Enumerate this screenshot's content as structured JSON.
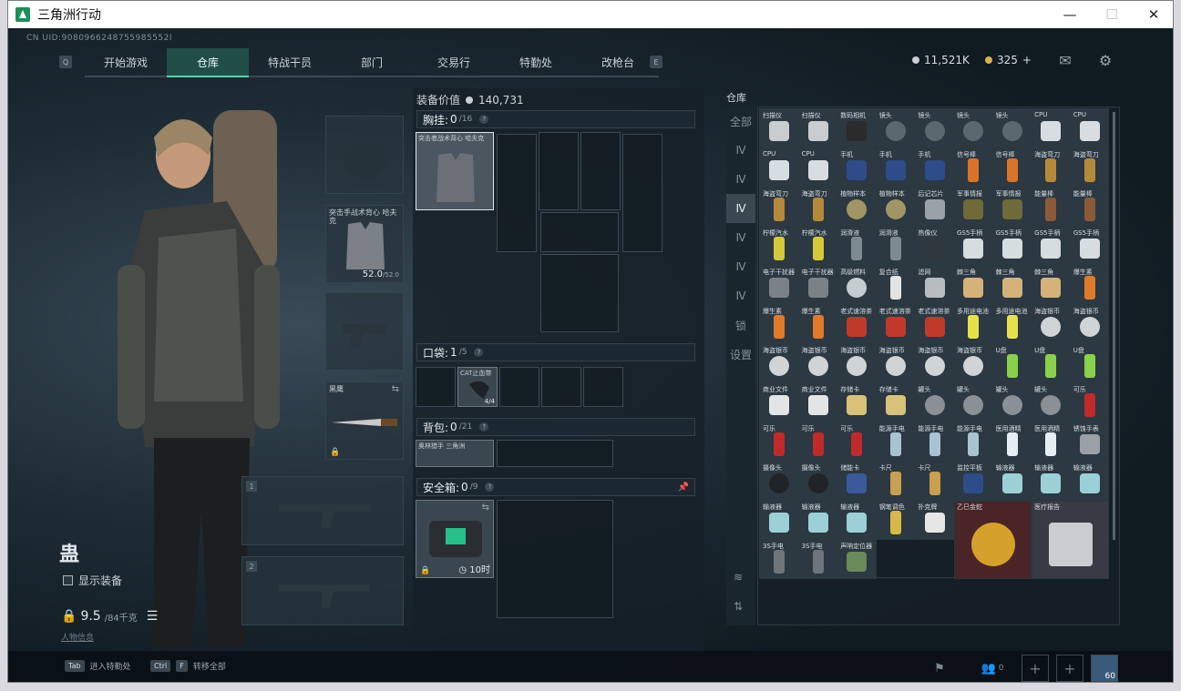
{
  "window": {
    "title": "三角洲行动",
    "minimize": "—",
    "maximize": "☐",
    "close": "✕"
  },
  "uid": "CN UID:9080966248755985552l",
  "nav": {
    "left_key": "Q",
    "right_key": "E",
    "tabs": [
      {
        "label": "开始游戏",
        "active": false
      },
      {
        "label": "仓库",
        "active": true
      },
      {
        "label": "特战干员",
        "active": false
      },
      {
        "label": "部门",
        "active": false
      },
      {
        "label": "交易行",
        "active": false
      },
      {
        "label": "特勤处",
        "active": false
      },
      {
        "label": "改枪台",
        "active": false
      }
    ]
  },
  "currency": {
    "coins": "11,521K",
    "tickets": "325",
    "plus": "+"
  },
  "operator": {
    "name": "蛊",
    "show_equipment": "显示装备",
    "weight": "9.5",
    "weight_max": "/84千克",
    "link": "人物信息"
  },
  "equipment": {
    "vest_label": "突击手战术背心 哈夫克",
    "vest_durability": "52.0",
    "vest_durability_max": "/52.0",
    "melee_label": "黑鹰",
    "weapon_slot_1": "1",
    "weapon_slot_2": "2"
  },
  "loadout": {
    "value_label": "装备价值",
    "value": "140,731",
    "rig": {
      "title": "胸挂:",
      "count": "0",
      "max": "/16",
      "item": "突击者战术背心 哈夫克"
    },
    "pocket": {
      "title": "口袋:",
      "count": "1",
      "max": "/5",
      "item": "CAT止血带",
      "item_qty": "4/4"
    },
    "backpack": {
      "title": "背包:",
      "count": "0",
      "max": "/21",
      "item": "奥林猎手 三角洲"
    },
    "safe_box": {
      "title": "安全箱:",
      "count": "0",
      "max": "/9",
      "timer": "10时"
    }
  },
  "storage": {
    "title": "仓库",
    "side_tabs": [
      "全部",
      "Ⅳ",
      "Ⅳ",
      "Ⅳ",
      "Ⅳ",
      "Ⅳ",
      "Ⅳ",
      "锁",
      "设置"
    ],
    "items": [
      {
        "name": "扫描仪",
        "color": "#c9cdd0",
        "cls": ""
      },
      {
        "name": "扫描仪",
        "color": "#c9cdd0",
        "cls": ""
      },
      {
        "name": "数码相机",
        "color": "#2b2b2b",
        "cls": ""
      },
      {
        "name": "镜头",
        "color": "#5b6870",
        "cls": "round"
      },
      {
        "name": "镜头",
        "color": "#5b6870",
        "cls": "round"
      },
      {
        "name": "镜头",
        "color": "#5b6870",
        "cls": "round"
      },
      {
        "name": "镜头",
        "color": "#5b6870",
        "cls": "round"
      },
      {
        "name": "CPU",
        "color": "#d7dde0",
        "cls": ""
      },
      {
        "name": "CPU",
        "color": "#d7dde0",
        "cls": ""
      },
      {
        "name": "CPU",
        "color": "#d7dde0",
        "cls": ""
      },
      {
        "name": "CPU",
        "color": "#d7dde0",
        "cls": ""
      },
      {
        "name": "手机",
        "color": "#2e4c8a",
        "cls": ""
      },
      {
        "name": "手机",
        "color": "#2e4c8a",
        "cls": ""
      },
      {
        "name": "手机",
        "color": "#2e4c8a",
        "cls": ""
      },
      {
        "name": "信号棒",
        "color": "#d9742a",
        "cls": "tall"
      },
      {
        "name": "信号棒",
        "color": "#d9742a",
        "cls": "tall"
      },
      {
        "name": "海盗弯刀",
        "color": "#b48a3a",
        "cls": "tall"
      },
      {
        "name": "海盗弯刀",
        "color": "#b48a3a",
        "cls": "tall"
      },
      {
        "name": "海盗弯刀",
        "color": "#b48a3a",
        "cls": "tall"
      },
      {
        "name": "海盗弯刀",
        "color": "#b48a3a",
        "cls": "tall"
      },
      {
        "name": "植物样本",
        "color": "#a29565",
        "cls": "round"
      },
      {
        "name": "植物样本",
        "color": "#a29565",
        "cls": "round"
      },
      {
        "name": "后记芯片",
        "color": "#9aa2a8",
        "cls": ""
      },
      {
        "name": "军事情报",
        "color": "#6e6a3a",
        "cls": ""
      },
      {
        "name": "军事情报",
        "color": "#6e6a3a",
        "cls": ""
      },
      {
        "name": "能量棒",
        "color": "#8a5a38",
        "cls": "tall"
      },
      {
        "name": "能量棒",
        "color": "#8a5a38",
        "cls": "tall"
      },
      {
        "name": "柠檬汽水",
        "color": "#d5c83a",
        "cls": "tall"
      },
      {
        "name": "柠檬汽水",
        "color": "#d5c83a",
        "cls": "tall"
      },
      {
        "name": "润滑液",
        "color": "#7d8a92",
        "cls": "tall"
      },
      {
        "name": "润滑液",
        "color": "#7d8a92",
        "cls": "tall"
      },
      {
        "name": "热像仪",
        "color": "#30383e",
        "cls": ""
      },
      {
        "name": "GS5手柄",
        "color": "#d7dcdf",
        "cls": ""
      },
      {
        "name": "GS5手柄",
        "color": "#d7dcdf",
        "cls": ""
      },
      {
        "name": "GS5手柄",
        "color": "#d7dcdf",
        "cls": ""
      },
      {
        "name": "GS5手柄",
        "color": "#d7dcdf",
        "cls": ""
      },
      {
        "name": "电子干扰器",
        "color": "#7a8288",
        "cls": ""
      },
      {
        "name": "电子干扰器",
        "color": "#7a8288",
        "cls": ""
      },
      {
        "name": "高级燃料",
        "color": "#c5ccd0",
        "cls": "round"
      },
      {
        "name": "复合纸",
        "color": "#e1e4e6",
        "cls": "tall"
      },
      {
        "name": "滤网",
        "color": "#b7bcc0",
        "cls": ""
      },
      {
        "name": "棘三角",
        "color": "#d4b27a",
        "cls": ""
      },
      {
        "name": "棘三角",
        "color": "#d4b27a",
        "cls": ""
      },
      {
        "name": "棘三角",
        "color": "#d4b27a",
        "cls": ""
      },
      {
        "name": "爆生素",
        "color": "#e07a2a",
        "cls": "tall"
      },
      {
        "name": "爆生素",
        "color": "#e07a2a",
        "cls": "tall"
      },
      {
        "name": "爆生素",
        "color": "#e07a2a",
        "cls": "tall"
      },
      {
        "name": "老式速溶茶",
        "color": "#c0392b",
        "cls": ""
      },
      {
        "name": "老式速溶茶",
        "color": "#c0392b",
        "cls": ""
      },
      {
        "name": "老式速溶茶",
        "color": "#c0392b",
        "cls": ""
      },
      {
        "name": "多用途电池",
        "color": "#e6e04a",
        "cls": "tall"
      },
      {
        "name": "多用途电池",
        "color": "#e6e04a",
        "cls": "tall"
      },
      {
        "name": "海盗银币",
        "color": "#d0d4d6",
        "cls": "round"
      },
      {
        "name": "海盗银币",
        "color": "#d0d4d6",
        "cls": "round"
      },
      {
        "name": "海盗银币",
        "color": "#d0d4d6",
        "cls": "round"
      },
      {
        "name": "海盗银币",
        "color": "#d0d4d6",
        "cls": "round"
      },
      {
        "name": "海盗银币",
        "color": "#d0d4d6",
        "cls": "round"
      },
      {
        "name": "海盗银币",
        "color": "#d0d4d6",
        "cls": "round"
      },
      {
        "name": "海盗银币",
        "color": "#d0d4d6",
        "cls": "round"
      },
      {
        "name": "海盗银币",
        "color": "#d0d4d6",
        "cls": "round"
      },
      {
        "name": "U盘",
        "color": "#8ad14a",
        "cls": "tall"
      },
      {
        "name": "U盘",
        "color": "#8ad14a",
        "cls": "tall"
      },
      {
        "name": "U盘",
        "color": "#8ad14a",
        "cls": "tall"
      },
      {
        "name": "商业文件",
        "color": "#e2e4e6",
        "cls": ""
      },
      {
        "name": "商业文件",
        "color": "#e2e4e6",
        "cls": ""
      },
      {
        "name": "存储卡",
        "color": "#d8c27a",
        "cls": ""
      },
      {
        "name": "存储卡",
        "color": "#d8c27a",
        "cls": ""
      },
      {
        "name": "罐头",
        "color": "#8a9096",
        "cls": "round"
      },
      {
        "name": "罐头",
        "color": "#8a9096",
        "cls": "round"
      },
      {
        "name": "罐头",
        "color": "#8a9096",
        "cls": "round"
      },
      {
        "name": "罐头",
        "color": "#8a9096",
        "cls": "round"
      },
      {
        "name": "可乐",
        "color": "#c02a2a",
        "cls": "tall"
      },
      {
        "name": "可乐",
        "color": "#c02a2a",
        "cls": "tall"
      },
      {
        "name": "可乐",
        "color": "#c02a2a",
        "cls": "tall"
      },
      {
        "name": "可乐",
        "color": "#c02a2a",
        "cls": "tall"
      },
      {
        "name": "能源手电",
        "color": "#a9c4d0",
        "cls": "tall"
      },
      {
        "name": "能源手电",
        "color": "#a9c4d0",
        "cls": "tall"
      },
      {
        "name": "能源手电",
        "color": "#a9c4d0",
        "cls": "tall"
      },
      {
        "name": "医用酒精",
        "color": "#e6eef2",
        "cls": "tall"
      },
      {
        "name": "医用酒精",
        "color": "#e6eef2",
        "cls": "tall"
      },
      {
        "name": "锈蚀手表",
        "color": "#9aa0a6",
        "cls": ""
      },
      {
        "name": "摄像头",
        "color": "#202428",
        "cls": "round"
      },
      {
        "name": "摄像头",
        "color": "#202428",
        "cls": "round"
      },
      {
        "name": "储能卡",
        "color": "#3a5a9a",
        "cls": ""
      },
      {
        "name": "卡尺",
        "color": "#c8a050",
        "cls": "tall"
      },
      {
        "name": "卡尺",
        "color": "#c8a050",
        "cls": "tall"
      },
      {
        "name": "监控平板",
        "color": "#2e4c8a",
        "cls": ""
      },
      {
        "name": "输液器",
        "color": "#9ad0d6",
        "cls": ""
      },
      {
        "name": "输液器",
        "color": "#9ad0d6",
        "cls": ""
      },
      {
        "name": "输液器",
        "color": "#9ad0d6",
        "cls": ""
      },
      {
        "name": "输液器",
        "color": "#9ad0d6",
        "cls": ""
      },
      {
        "name": "输液器",
        "color": "#9ad0d6",
        "cls": ""
      },
      {
        "name": "输液器",
        "color": "#9ad0d6",
        "cls": ""
      },
      {
        "name": "钢笔调色",
        "color": "#d8b84a",
        "cls": "tall"
      },
      {
        "name": "扑克牌",
        "color": "#e6e6e6",
        "cls": ""
      },
      {
        "name": "乙巳金蛇",
        "color": "#d6a12a",
        "cls": "round",
        "big": "gold-big"
      },
      {
        "name": "医疗报告",
        "color": "#c9cdd0",
        "cls": "",
        "big": "card-big"
      },
      {
        "name": "3S手电",
        "color": "#6e767c",
        "cls": "tall"
      },
      {
        "name": "3S手电",
        "color": "#6e767c",
        "cls": "tall"
      },
      {
        "name": "声呐定位器",
        "color": "#6a8a5a",
        "cls": ""
      }
    ]
  },
  "bottom": {
    "tab_key": "Tab",
    "tab_hint": "进入特勤处",
    "ctrl_key": "Ctrl",
    "f_key": "F",
    "transfer_hint": "转移全部",
    "squad_count": "0",
    "level": "60"
  }
}
